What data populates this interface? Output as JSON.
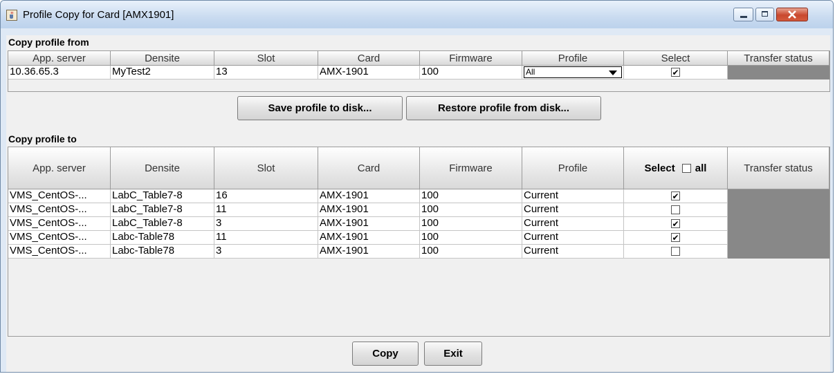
{
  "window": {
    "title": "Profile Copy for Card [AMX1901]"
  },
  "from_section": {
    "label": "Copy profile from",
    "columns": [
      "App. server",
      "Densite",
      "Slot",
      "Card",
      "Firmware",
      "Profile",
      "Select",
      "Transfer status"
    ],
    "row": {
      "app_server": "10.36.65.3",
      "densite": "MyTest2",
      "slot": "13",
      "card": "AMX-1901",
      "firmware": "100",
      "profile": "All",
      "select": true
    }
  },
  "buttons": {
    "save_to_disk": "Save profile to disk...",
    "restore_from_disk": "Restore profile from disk...",
    "copy": "Copy",
    "exit": "Exit"
  },
  "to_section": {
    "label": "Copy profile to",
    "columns": [
      "App. server",
      "Densite",
      "Slot",
      "Card",
      "Firmware",
      "Profile",
      "Select",
      "Transfer status"
    ],
    "select_all_label": "all",
    "select_all_checked": false,
    "rows": [
      {
        "app_server": "VMS_CentOS-...",
        "densite": "LabC_Table7-8",
        "slot": "16",
        "card": "AMX-1901",
        "firmware": "100",
        "profile": "Current",
        "select": true
      },
      {
        "app_server": "VMS_CentOS-...",
        "densite": "LabC_Table7-8",
        "slot": "11",
        "card": "AMX-1901",
        "firmware": "100",
        "profile": "Current",
        "select": false
      },
      {
        "app_server": "VMS_CentOS-...",
        "densite": "LabC_Table7-8",
        "slot": "3",
        "card": "AMX-1901",
        "firmware": "100",
        "profile": "Current",
        "select": true
      },
      {
        "app_server": "VMS_CentOS-...",
        "densite": "Labc-Table78",
        "slot": "11",
        "card": "AMX-1901",
        "firmware": "100",
        "profile": "Current",
        "select": true
      },
      {
        "app_server": "VMS_CentOS-...",
        "densite": "Labc-Table78",
        "slot": "3",
        "card": "AMX-1901",
        "firmware": "100",
        "profile": "Current",
        "select": false
      }
    ]
  },
  "icons": {
    "app": "java-cup-icon",
    "minimize": "minimize-icon",
    "maximize": "maximize-icon",
    "close": "close-icon"
  },
  "colors": {
    "status_cell": "#888888",
    "titlebar": "#c9dbf0",
    "close_button": "#c9482e"
  }
}
